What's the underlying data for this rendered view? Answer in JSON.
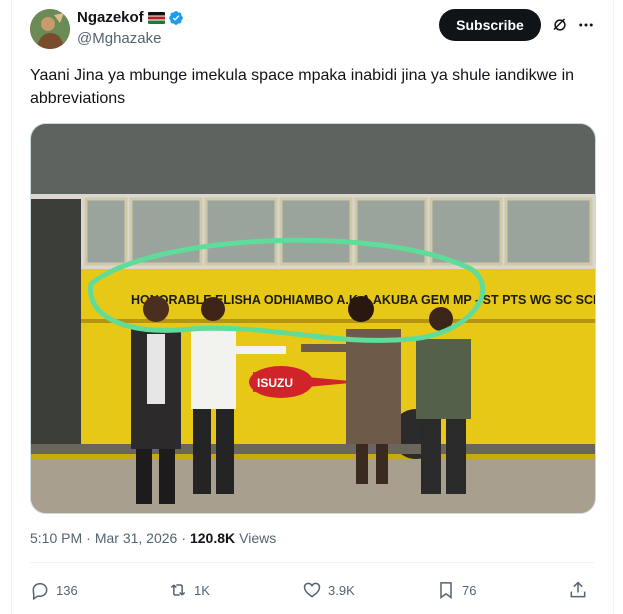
{
  "author": {
    "display_name": "Ngazekof",
    "handle": "@Mghazake",
    "avatar_icon": "avatar-photo",
    "flag_icon": "kenya-flag-icon",
    "verified_color": "#1d9bf0"
  },
  "header": {
    "subscribe_label": "Subscribe",
    "grok_icon": "grok-icon",
    "more_icon": "more-icon"
  },
  "tweet": {
    "text": "Yaani Jina ya mbunge imekula space mpaka inabidi jina ya shule iandikwe in abbreviations",
    "image": {
      "bus_text": "HONORABLE ELISHA ODHIAMBO A.K.A AKUBA GEM MP - ST PTS WG SC SCH",
      "logo_text": "ISUZU",
      "highlight_color": "#5fdc9a",
      "bus_color": "#e8c816"
    },
    "time": "5:10 PM",
    "separator": "·",
    "date": "Mar 31, 2026",
    "separator2": "·",
    "views_count": "120.8K",
    "views_label": "Views"
  },
  "actions": {
    "replies": "136",
    "reposts": "1K",
    "likes": "3.9K",
    "bookmarks": "76"
  }
}
